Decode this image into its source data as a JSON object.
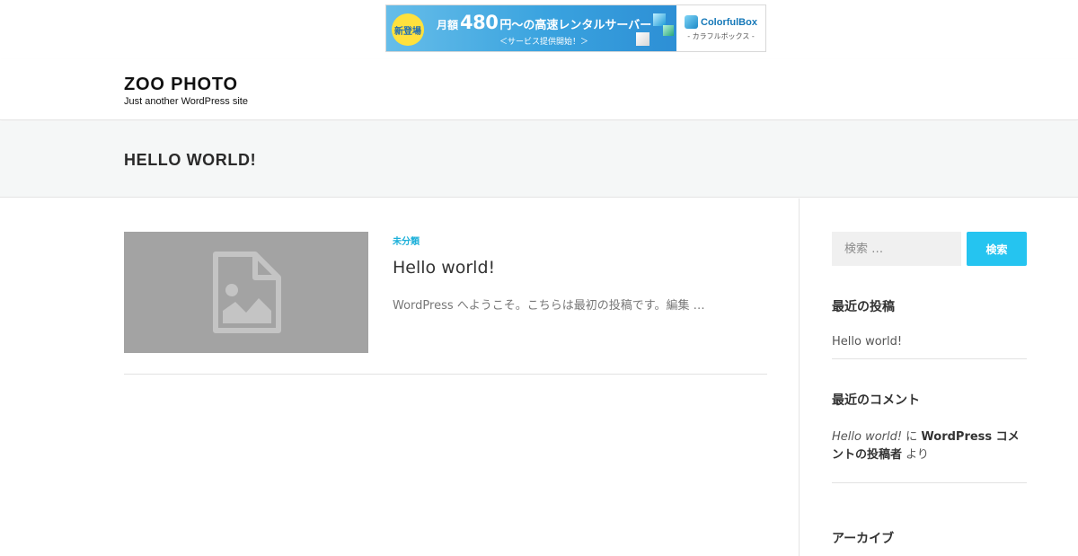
{
  "banner": {
    "badge": "新登場",
    "prefix": "月額",
    "price": "480",
    "suffix": "円～の高速レンタルサーバー",
    "subline": "＜サービス提供開始！＞",
    "brand": "ColorfulBox",
    "brand_sub": "- カラフルボックス -"
  },
  "header": {
    "site_title": "ZOO PHOTO",
    "site_description": "Just another WordPress site"
  },
  "page": {
    "title": "HELLO WORLD!"
  },
  "post": {
    "category": "未分類",
    "title": "Hello world!",
    "excerpt": "WordPress へようこそ。こちらは最初の投稿です。編集 …"
  },
  "sidebar": {
    "search_placeholder": "検索 …",
    "search_button": "検索",
    "recent_posts_title": "最近の投稿",
    "recent_posts": [
      "Hello world!"
    ],
    "recent_comments_title": "最近のコメント",
    "comment": {
      "post": "Hello world!",
      "connector": "に",
      "author": "WordPress コメントの投稿者",
      "suffix": "より"
    },
    "archives_title": "アーカイブ"
  },
  "colors": {
    "accent": "#25c4f0",
    "category": "#1cb0d9",
    "thumbnail_bg": "#a3a3a3",
    "band_bg": "#f5f7f7"
  }
}
